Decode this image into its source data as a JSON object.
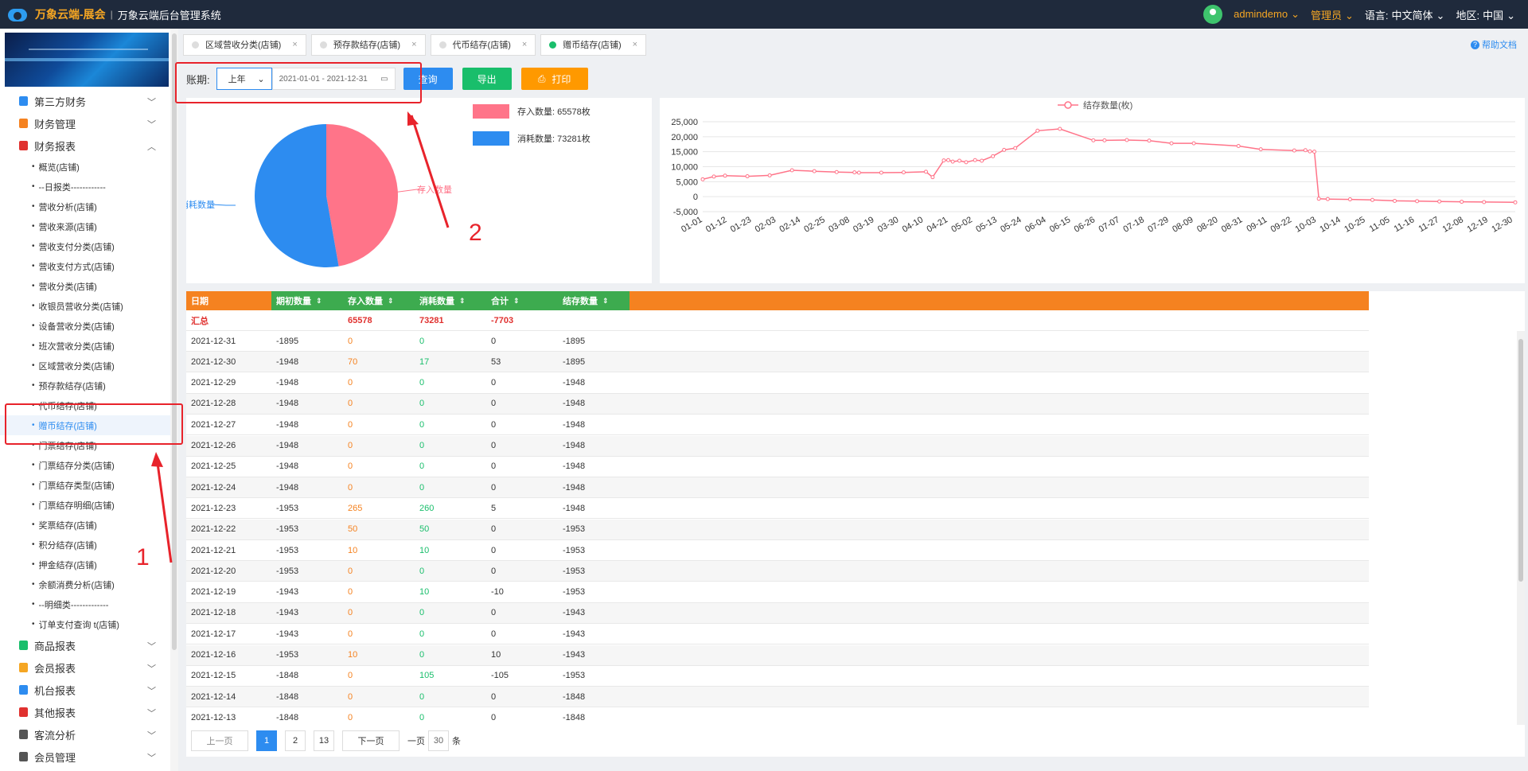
{
  "topbar": {
    "brand": "万象云端-展会",
    "separator": "|",
    "system_name": "万象云端后台管理系统",
    "user": "admindemo",
    "role": "管理员",
    "language_label": "语言:",
    "language_value": "中文简体",
    "region_label": "地区:",
    "region_value": "中国"
  },
  "sidebar": {
    "groups_top": [
      {
        "label": "第三方财务",
        "color": "#2d8cf0"
      },
      {
        "label": "财务管理",
        "color": "#f58220"
      },
      {
        "label": "财务报表",
        "color": "#e0312f"
      }
    ],
    "sub_items": [
      "概览(店铺)",
      "--日报类------------",
      "营收分析(店铺)",
      "营收来源(店铺)",
      "营收支付分类(店铺)",
      "营收支付方式(店铺)",
      "营收分类(店铺)",
      "收银员营收分类(店铺)",
      "设备营收分类(店铺)",
      "班次营收分类(店铺)",
      "区域营收分类(店铺)",
      "预存款结存(店铺)",
      "代币结存(店铺)",
      "赠币结存(店铺)",
      "门票结存(店铺)",
      "门票结存分类(店铺)",
      "门票结存类型(店铺)",
      "门票结存明细(店铺)",
      "奖票结存(店铺)",
      "积分结存(店铺)",
      "押金结存(店铺)",
      "余额消费分析(店铺)",
      "--明细类-------------",
      "订单支付查询 t(店铺)"
    ],
    "active_sub": "赠币结存(店铺)",
    "groups_bottom": [
      {
        "label": "商品报表",
        "color": "#19be6b"
      },
      {
        "label": "会员报表",
        "color": "#f5a623"
      },
      {
        "label": "机台报表",
        "color": "#2d8cf0"
      },
      {
        "label": "其他报表",
        "color": "#e0312f"
      },
      {
        "label": "客流分析",
        "color": "#555555"
      },
      {
        "label": "会员管理",
        "color": "#555555"
      }
    ]
  },
  "tabs": [
    {
      "label": "区域营收分类(店铺)",
      "active": false
    },
    {
      "label": "预存款结存(店铺)",
      "active": false
    },
    {
      "label": "代币结存(店铺)",
      "active": false
    },
    {
      "label": "赠币结存(店铺)",
      "active": true
    }
  ],
  "help_label": "帮助文档",
  "filter": {
    "label": "账期:",
    "period": "上年",
    "date_range": "2021-01-01 - 2021-12-31",
    "query": "查询",
    "export": "导出",
    "print": "打印"
  },
  "pie": {
    "legend_in": "存入数量: 65578枚",
    "legend_out": "消耗数量: 73281枚",
    "label_in": "存入数量",
    "label_out": "消耗数量",
    "color_in": "#ff7489",
    "color_out": "#2d8cf0"
  },
  "chart_data": {
    "type": "line",
    "legend": "结存数量(枚)",
    "color": "#ff7489",
    "ylim": [
      -5000,
      25000
    ],
    "yticks": [
      "25,000",
      "20,000",
      "15,000",
      "10,000",
      "5,000",
      "0",
      "-5,000"
    ],
    "xticks": [
      "01-01",
      "01-12",
      "01-23",
      "02-03",
      "02-14",
      "02-25",
      "03-08",
      "03-19",
      "03-30",
      "04-10",
      "04-21",
      "05-02",
      "05-13",
      "05-24",
      "06-04",
      "06-15",
      "06-26",
      "07-07",
      "07-18",
      "07-29",
      "08-09",
      "08-20",
      "08-31",
      "09-11",
      "09-22",
      "10-03",
      "10-14",
      "10-25",
      "11-05",
      "11-16",
      "11-27",
      "12-08",
      "12-19",
      "12-30"
    ],
    "x_day": [
      0,
      5,
      10,
      20,
      30,
      40,
      50,
      60,
      68,
      70,
      80,
      90,
      100,
      103,
      108,
      110,
      112,
      115,
      118,
      122,
      125,
      130,
      135,
      140,
      150,
      160,
      175,
      180,
      190,
      200,
      210,
      220,
      240,
      250,
      265,
      270,
      272,
      274,
      276,
      280,
      290,
      300,
      310,
      320,
      330,
      340,
      350,
      364
    ],
    "values": [
      5800,
      6700,
      7000,
      6800,
      7100,
      8800,
      8500,
      8200,
      8100,
      8000,
      8000,
      8100,
      8300,
      6500,
      12100,
      12200,
      11700,
      12000,
      11500,
      12200,
      12000,
      13500,
      15600,
      16200,
      22000,
      22600,
      18800,
      18800,
      18900,
      18700,
      17800,
      17800,
      16900,
      15800,
      15400,
      15500,
      15100,
      15000,
      -700,
      -800,
      -900,
      -1100,
      -1400,
      -1500,
      -1600,
      -1700,
      -1800,
      -1900
    ]
  },
  "table": {
    "headers": [
      "日期",
      "期初数量",
      "存入数量",
      "消耗数量",
      "合计",
      "结存数量"
    ],
    "summary": {
      "date": "汇总",
      "open": "",
      "in": "65578",
      "out": "73281",
      "sum": "-7703",
      "bal": ""
    },
    "rows": [
      [
        "2021-12-31",
        "-1895",
        "0",
        "0",
        "0",
        "-1895"
      ],
      [
        "2021-12-30",
        "-1948",
        "70",
        "17",
        "53",
        "-1895"
      ],
      [
        "2021-12-29",
        "-1948",
        "0",
        "0",
        "0",
        "-1948"
      ],
      [
        "2021-12-28",
        "-1948",
        "0",
        "0",
        "0",
        "-1948"
      ],
      [
        "2021-12-27",
        "-1948",
        "0",
        "0",
        "0",
        "-1948"
      ],
      [
        "2021-12-26",
        "-1948",
        "0",
        "0",
        "0",
        "-1948"
      ],
      [
        "2021-12-25",
        "-1948",
        "0",
        "0",
        "0",
        "-1948"
      ],
      [
        "2021-12-24",
        "-1948",
        "0",
        "0",
        "0",
        "-1948"
      ],
      [
        "2021-12-23",
        "-1953",
        "265",
        "260",
        "5",
        "-1948"
      ],
      [
        "2021-12-22",
        "-1953",
        "50",
        "50",
        "0",
        "-1953"
      ],
      [
        "2021-12-21",
        "-1953",
        "10",
        "10",
        "0",
        "-1953"
      ],
      [
        "2021-12-20",
        "-1953",
        "0",
        "0",
        "0",
        "-1953"
      ],
      [
        "2021-12-19",
        "-1943",
        "0",
        "10",
        "-10",
        "-1953"
      ],
      [
        "2021-12-18",
        "-1943",
        "0",
        "0",
        "0",
        "-1943"
      ],
      [
        "2021-12-17",
        "-1943",
        "0",
        "0",
        "0",
        "-1943"
      ],
      [
        "2021-12-16",
        "-1953",
        "10",
        "0",
        "10",
        "-1943"
      ],
      [
        "2021-12-15",
        "-1848",
        "0",
        "105",
        "-105",
        "-1953"
      ],
      [
        "2021-12-14",
        "-1848",
        "0",
        "0",
        "0",
        "-1848"
      ],
      [
        "2021-12-13",
        "-1848",
        "0",
        "0",
        "0",
        "-1848"
      ]
    ]
  },
  "pager": {
    "prev": "上一页",
    "pages": [
      "1",
      "2",
      "13"
    ],
    "next": "下一页",
    "per_page_prefix": "一页",
    "per_page": "30",
    "per_page_suffix": "条"
  },
  "annotations": {
    "num1": "1",
    "num2": "2"
  }
}
